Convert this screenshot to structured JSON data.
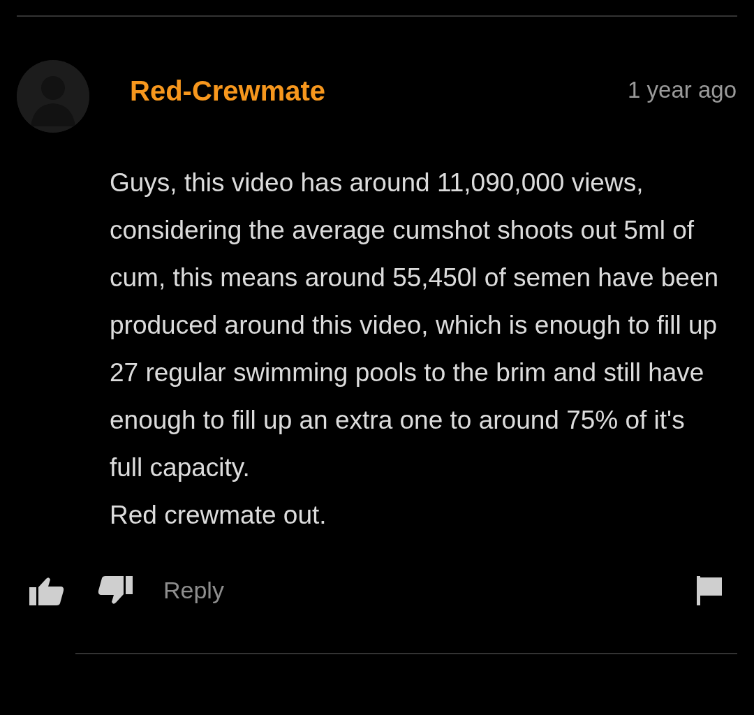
{
  "comment": {
    "author": "Red-Crewmate",
    "time": "1 year ago",
    "body": "Guys, this video has around 11,090,000 views, considering the average cumshot shoots out 5ml of cum, this means around 55,450l of semen have been produced around this video, which is enough to fill up 27 regular swimming pools to the brim and still have enough to fill up an extra one to around 75% of it's full capacity.\nRed crewmate out.",
    "reply": "Reply"
  }
}
